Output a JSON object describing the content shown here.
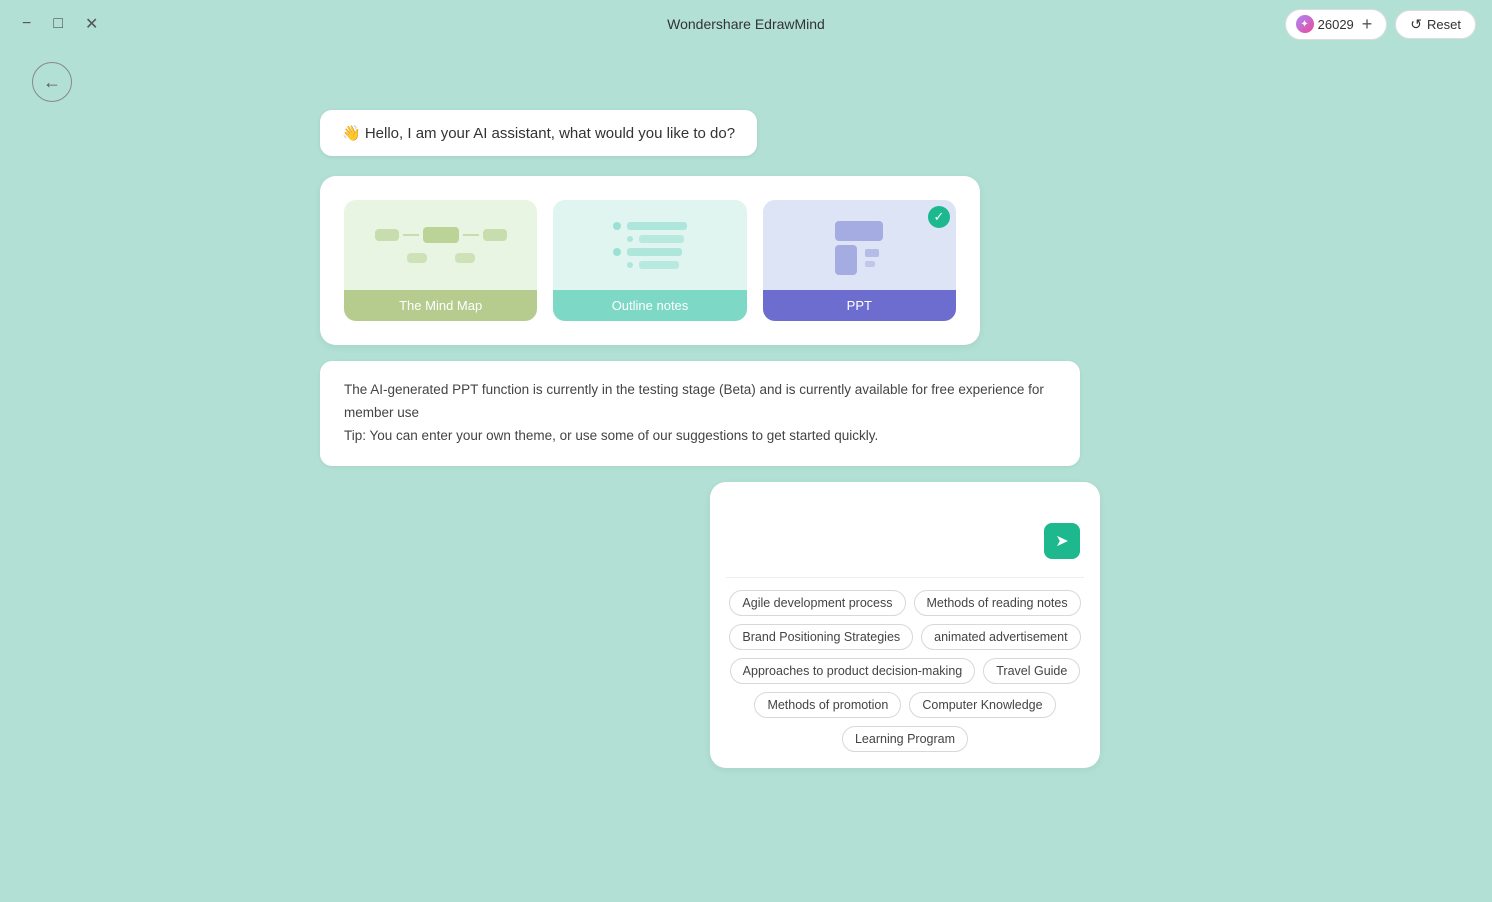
{
  "app": {
    "title": "Wondershare EdrawMind"
  },
  "titlebar": {
    "credits": "26029",
    "reset_label": "Reset",
    "back_aria": "Go back"
  },
  "greeting": {
    "text": "👋 Hello, I am your AI assistant, what would you like to do?"
  },
  "mode_selection": {
    "options": [
      {
        "id": "mindmap",
        "label": "The Mind Map",
        "selected": false
      },
      {
        "id": "outline",
        "label": "Outline notes",
        "selected": false
      },
      {
        "id": "ppt",
        "label": "PPT",
        "selected": true
      }
    ]
  },
  "info_text": {
    "line1": "The AI-generated PPT function is currently in the testing stage (Beta) and is currently available for free experience for member use",
    "line2": "Tip: You can enter your own theme, or use some of our suggestions to get started quickly."
  },
  "input": {
    "placeholder": "",
    "send_icon": "➤"
  },
  "tags": [
    "Agile development process",
    "Methods of reading notes",
    "Brand Positioning Strategies",
    "animated advertisement",
    "Approaches to product decision-making",
    "Travel Guide",
    "Methods of promotion",
    "Computer Knowledge",
    "Learning Program"
  ]
}
